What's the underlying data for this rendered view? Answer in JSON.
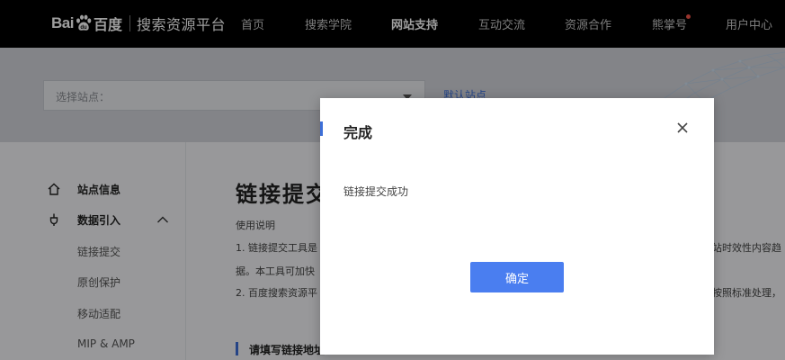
{
  "header": {
    "logo": {
      "bai": "Bai",
      "du": "百度",
      "subtitle": "搜索资源平台"
    },
    "nav": [
      {
        "label": "首页"
      },
      {
        "label": "搜索学院"
      },
      {
        "label": "网站支持"
      },
      {
        "label": "互动交流"
      },
      {
        "label": "资源合作"
      },
      {
        "label": "熊掌号"
      },
      {
        "label": "用户中心"
      }
    ],
    "active_nav": "网站支持"
  },
  "banner": {
    "site_select_label": "选择站点：",
    "default_site_link": "默认站点"
  },
  "sidebar": {
    "site_info": "站点信息",
    "data_import": "数据引入",
    "sub_items": [
      {
        "label": "链接提交"
      },
      {
        "label": "原创保护"
      },
      {
        "label": "移动适配"
      },
      {
        "label": "MIP & AMP"
      }
    ]
  },
  "main": {
    "page_title": "链接提交",
    "usage_title": "使用说明",
    "usage_lines": [
      {
        "left": "1. 链接提交工具是",
        "right": "站时效性内容趋"
      },
      {
        "left": "据。本工具可加快",
        "right": ""
      },
      {
        "left": "2. 百度搜索资源平",
        "right": "按照标准处理，"
      }
    ],
    "section_title": "请填写链接地址"
  },
  "dialog": {
    "title": "完成",
    "message": "链接提交成功",
    "confirm_label": "确定"
  },
  "colors": {
    "accent_blue": "#4a7ef0",
    "topbar": "#000000"
  }
}
